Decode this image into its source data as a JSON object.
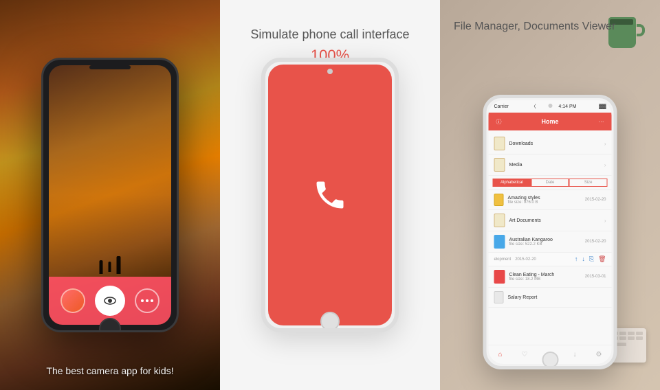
{
  "panel1": {
    "caption": "The best camera app for kids!"
  },
  "panel2": {
    "title": "Simulate phone call interface",
    "percent": "100%",
    "accent_color": "#e8534a"
  },
  "panel3": {
    "title": "File Manager, Documents Viewer",
    "phone": {
      "status": {
        "carrier": "Carrier",
        "time": "4:14 PM",
        "battery": "▓▓▓"
      },
      "nav": {
        "title": "Home",
        "info_icon": "ⓘ",
        "more_icon": "···"
      },
      "folders": [
        {
          "name": "Downloads",
          "type": "folder"
        },
        {
          "name": "Media",
          "type": "folder"
        }
      ],
      "sort_tabs": [
        {
          "label": "Alphabetical",
          "active": true
        },
        {
          "label": "Date",
          "active": false
        },
        {
          "label": "Size",
          "active": false
        }
      ],
      "files": [
        {
          "name": "Amazing styles",
          "meta": "file size: 976.0 B",
          "date": "2015-02-20",
          "type": "doc"
        },
        {
          "name": "Art Documents",
          "meta": "",
          "date": "",
          "type": "folder"
        },
        {
          "name": "Australian Kangaroo",
          "meta": "file size: 522.2 KB",
          "date": "2015-02-20",
          "type": "img"
        },
        {
          "name": "Clean Eating - March",
          "meta": "file size: 18.2 MB",
          "date": "2015-03-01",
          "type": "pdf"
        },
        {
          "name": "Salary Report",
          "meta": "",
          "date": "",
          "type": "doc"
        }
      ]
    }
  }
}
